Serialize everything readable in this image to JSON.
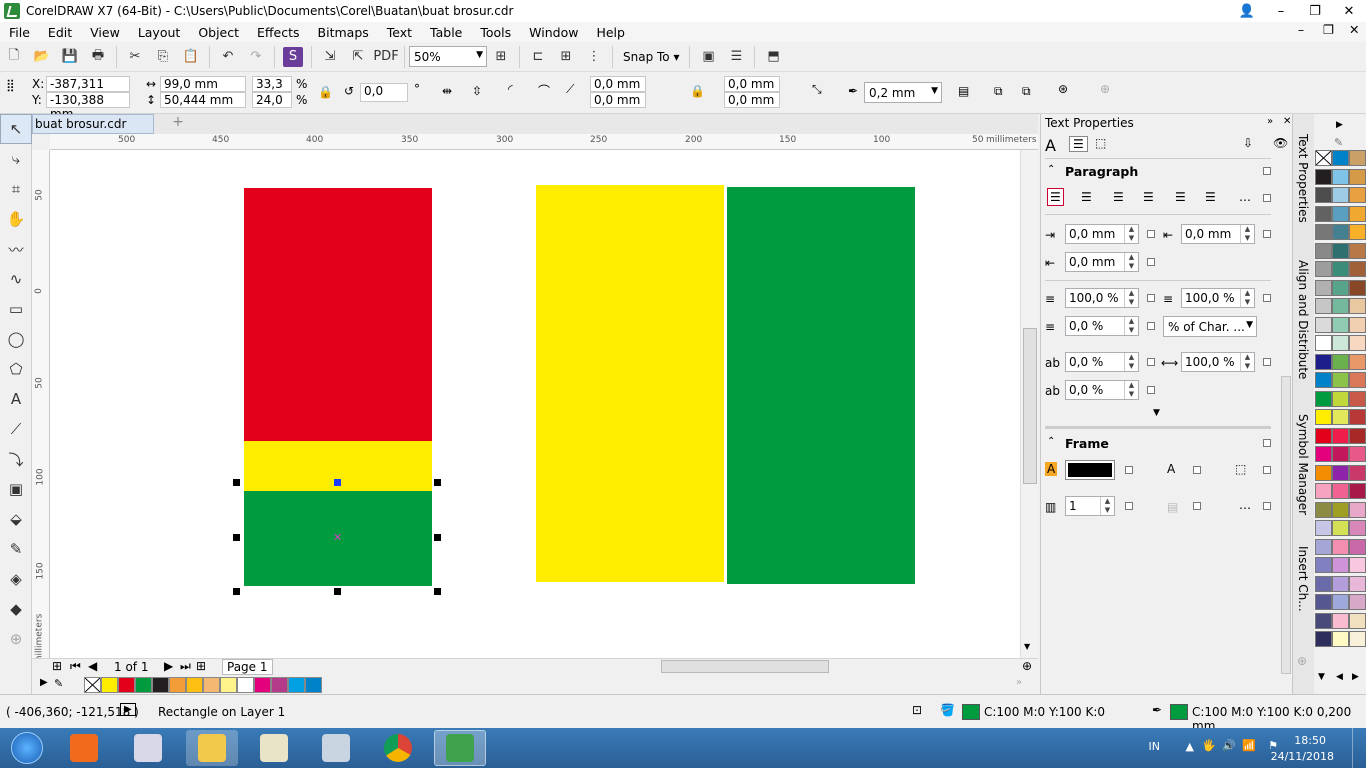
{
  "window": {
    "title": "CorelDRAW X7 (64-Bit) - C:\\Users\\Public\\Documents\\Corel\\Buatan\\buat brosur.cdr"
  },
  "menu": [
    "File",
    "Edit",
    "View",
    "Layout",
    "Object",
    "Effects",
    "Bitmaps",
    "Text",
    "Table",
    "Tools",
    "Window",
    "Help"
  ],
  "toolbar": {
    "zoom_value": "50%",
    "snap_label": "Snap To"
  },
  "propbar": {
    "x_label": "X:",
    "x_value": "-387,311 mm",
    "y_label": "Y:",
    "y_value": "-130,388 mm",
    "width_value": "99,0 mm",
    "height_value": "50,444 mm",
    "scale_w": "33,3",
    "scale_h": "24,0",
    "percent": "%",
    "rotation": "0,0",
    "degree": "°",
    "corner_1": "0,0 mm",
    "corner_2": "0,0 mm",
    "corner_3": "0,0 mm",
    "corner_4": "0,0 mm",
    "outline_width": "0,2 mm"
  },
  "doc_tab": "buat brosur.cdr",
  "ruler": {
    "h_ticks": [
      "500",
      "450",
      "400",
      "350",
      "300",
      "250",
      "200",
      "150",
      "100",
      "50"
    ],
    "h_unit": "millimeters",
    "v_ticks": [
      "50",
      "0",
      "50",
      "100",
      "150"
    ],
    "v_unit": "millimeters"
  },
  "pagebar": {
    "page_count": "1 of 1",
    "page_tab": "Page 1"
  },
  "colors": {
    "red": "#e3001b",
    "yellow": "#ffed00",
    "green": "#009b3e",
    "palette_doc": [
      "#ffed00",
      "#e3001b",
      "#009b3e",
      "#231f20",
      "#f29d38",
      "#fcbf12",
      "#f5b872",
      "#fff38a",
      "#ffffff",
      "#e4007d",
      "#b43a8a",
      "#00a0e3"
    ]
  },
  "docker": {
    "title": "Text Properties",
    "paragraph_title": "Paragraph",
    "left_indent": "0,0 mm",
    "first_line_indent": "0,0 mm",
    "right_indent": "0,0 mm",
    "line_spacing": "100,0 %",
    "before_paragraph": "100,0 %",
    "after_paragraph": "0,0 %",
    "spacing_unit": "% of Char. ...",
    "char_spacing": "0,0 %",
    "word_spacing": "100,0 %",
    "language_spacing": "0,0 %",
    "frame_title": "Frame",
    "columns": "1"
  },
  "vertical_tabs": [
    "Text Properties",
    "Align and Distribute",
    "Symbol Manager",
    "Insert Ch..."
  ],
  "status": {
    "coords": "( -406,360; -121,518 )",
    "object_info": "Rectangle on Layer 1",
    "fill_info": "C:100 M:0 Y:100 K:0",
    "outline_info": "C:100 M:0 Y:100 K:0  0,200 mm"
  },
  "taskbar": {
    "lang": "IN",
    "time": "18:50",
    "date": "24/11/2018"
  }
}
